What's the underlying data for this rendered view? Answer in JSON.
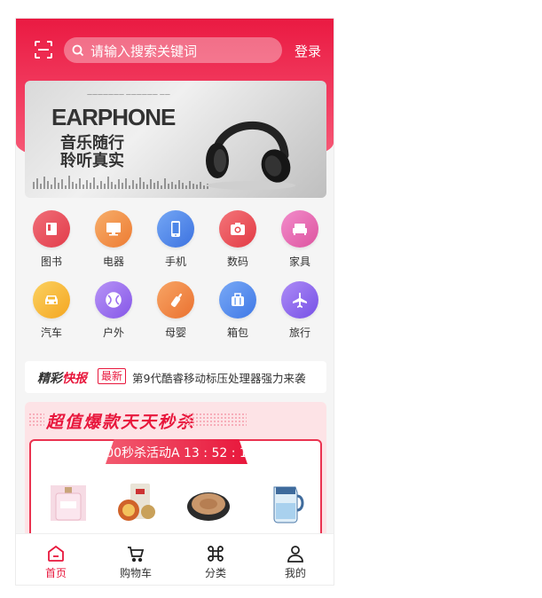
{
  "header": {
    "search_placeholder": "请输入搜索关键词",
    "login_label": "登录"
  },
  "banner": {
    "title": "EARPHONE",
    "line1": "音乐随行",
    "line2": "聆听真实",
    "slide_count": 4,
    "active_slide": 1
  },
  "categories": [
    {
      "label": "图书",
      "icon": "book-icon",
      "color": "#e64a56"
    },
    {
      "label": "电器",
      "icon": "monitor-icon",
      "color": "#ef8a3e"
    },
    {
      "label": "手机",
      "icon": "phone-icon",
      "color": "#4c86e8"
    },
    {
      "label": "数码",
      "icon": "camera-icon",
      "color": "#e94a4f"
    },
    {
      "label": "家具",
      "icon": "sofa-icon",
      "color": "#e56cb3"
    },
    {
      "label": "汽车",
      "icon": "car-icon",
      "color": "#f7b731"
    },
    {
      "label": "户外",
      "icon": "ball-icon",
      "color": "#9b6ef0"
    },
    {
      "label": "母婴",
      "icon": "bottle-icon",
      "color": "#f08a3c"
    },
    {
      "label": "箱包",
      "icon": "bag-icon",
      "color": "#4f8ef0"
    },
    {
      "label": "旅行",
      "icon": "plane-icon",
      "color": "#9066f0"
    }
  ],
  "news": {
    "brand_a": "精彩",
    "brand_b": "快报",
    "tag": "最新",
    "text": "第9代酷睿移动标压处理器强力来袭"
  },
  "flash_sale": {
    "title": "超值爆款天天秒杀",
    "ribbon": "00秒杀活动A 13 : 52 : 1",
    "products": [
      "perfume-bottle",
      "food-gift-pack",
      "electric-baking-pan",
      "water-filter-pitcher"
    ]
  },
  "tabbar": [
    {
      "label": "首页",
      "icon": "home-icon",
      "active": true
    },
    {
      "label": "购物车",
      "icon": "cart-icon",
      "active": false
    },
    {
      "label": "分类",
      "icon": "category-icon",
      "active": false
    },
    {
      "label": "我的",
      "icon": "user-icon",
      "active": false
    }
  ],
  "colors": {
    "accent": "#e8173c"
  }
}
